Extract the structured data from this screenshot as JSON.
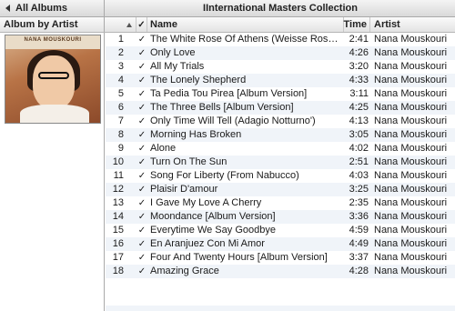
{
  "topbar": {
    "all_albums_label": "All Albums",
    "collection_title": "IInternational Masters Collection"
  },
  "columns": {
    "album": "Album by Artist",
    "check": "✓",
    "name": "Name",
    "time": "Time",
    "artist": "Artist"
  },
  "album": {
    "cover_text": "NANA MOUSKOURI"
  },
  "tracks": [
    {
      "num": "1",
      "check": "✓",
      "name": "The White Rose Of Athens (Weisse Rosen Aus ...",
      "time": "2:41",
      "artist": "Nana Mouskouri"
    },
    {
      "num": "2",
      "check": "✓",
      "name": "Only Love",
      "time": "4:26",
      "artist": "Nana Mouskouri"
    },
    {
      "num": "3",
      "check": "✓",
      "name": "All My Trials",
      "time": "3:20",
      "artist": "Nana Mouskouri"
    },
    {
      "num": "4",
      "check": "✓",
      "name": "The Lonely Shepherd",
      "time": "4:33",
      "artist": "Nana Mouskouri"
    },
    {
      "num": "5",
      "check": "✓",
      "name": "Ta Pedia Tou Pirea [Album Version]",
      "time": "3:11",
      "artist": "Nana Mouskouri"
    },
    {
      "num": "6",
      "check": "✓",
      "name": "The Three Bells [Album Version]",
      "time": "4:25",
      "artist": "Nana Mouskouri"
    },
    {
      "num": "7",
      "check": "✓",
      "name": "Only Time Will Tell (Adagio Notturno')",
      "time": "4:13",
      "artist": "Nana Mouskouri"
    },
    {
      "num": "8",
      "check": "✓",
      "name": "Morning Has Broken",
      "time": "3:05",
      "artist": "Nana Mouskouri"
    },
    {
      "num": "9",
      "check": "✓",
      "name": "Alone",
      "time": "4:02",
      "artist": "Nana Mouskouri"
    },
    {
      "num": "10",
      "check": "✓",
      "name": "Turn On The Sun",
      "time": "2:51",
      "artist": "Nana Mouskouri"
    },
    {
      "num": "11",
      "check": "✓",
      "name": "Song For Liberty (From Nabucco)",
      "time": "4:03",
      "artist": "Nana Mouskouri"
    },
    {
      "num": "12",
      "check": "✓",
      "name": "Plaisir D'amour",
      "time": "3:25",
      "artist": "Nana Mouskouri"
    },
    {
      "num": "13",
      "check": "✓",
      "name": "I Gave My Love A Cherry",
      "time": "2:35",
      "artist": "Nana Mouskouri"
    },
    {
      "num": "14",
      "check": "✓",
      "name": "Moondance [Album Version]",
      "time": "3:36",
      "artist": "Nana Mouskouri"
    },
    {
      "num": "15",
      "check": "✓",
      "name": "Everytime We Say Goodbye",
      "time": "4:59",
      "artist": "Nana Mouskouri"
    },
    {
      "num": "16",
      "check": "✓",
      "name": "En Aranjuez Con Mi Amor",
      "time": "4:49",
      "artist": "Nana Mouskouri"
    },
    {
      "num": "17",
      "check": "✓",
      "name": "Four And Twenty Hours [Album Version]",
      "time": "3:37",
      "artist": "Nana Mouskouri"
    },
    {
      "num": "18",
      "check": "✓",
      "name": "Amazing Grace",
      "time": "4:28",
      "artist": "Nana Mouskouri"
    }
  ]
}
